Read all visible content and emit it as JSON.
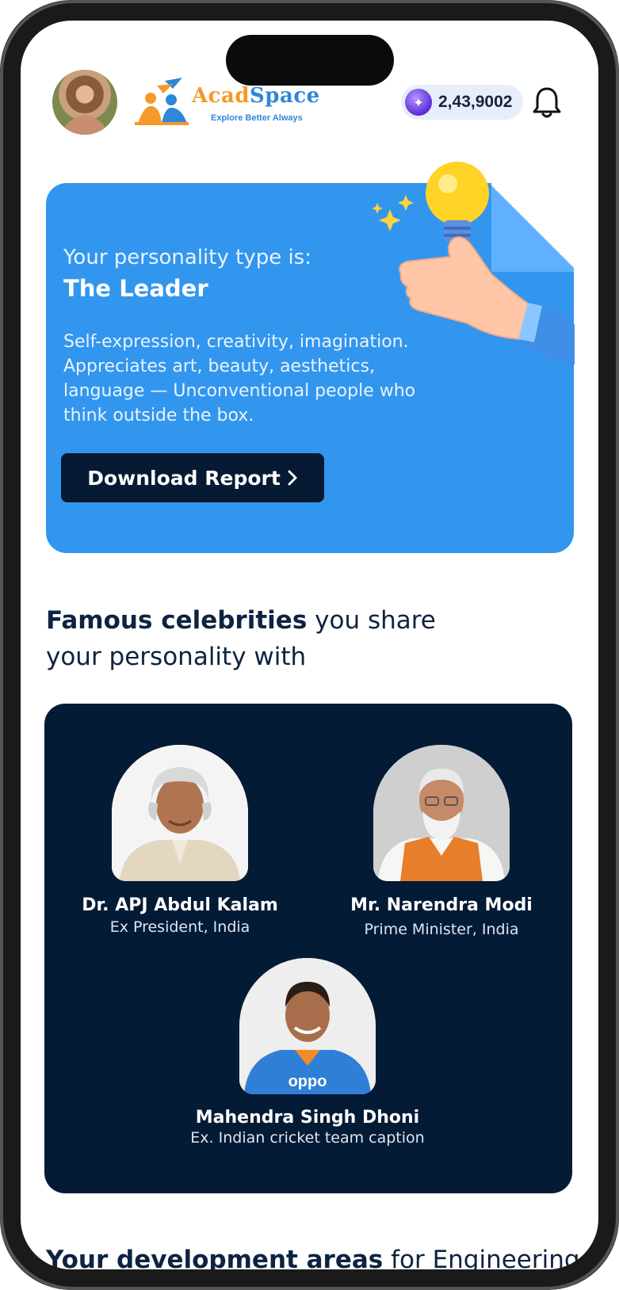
{
  "header": {
    "logo_title_part1": "Acad",
    "logo_title_part2": "Space",
    "logo_tagline": "Explore Better Always",
    "coins": "2,43,9002",
    "icons": [
      "avatar",
      "coin-icon",
      "bell-icon"
    ]
  },
  "hero": {
    "label": "Your personality type is:",
    "title": "The Leader",
    "description_lines": [
      "Self-expression, creativity, imagination.",
      "Appreciates art, beauty, aesthetics,",
      "language  — Unconventional people who",
      "think outside  the box."
    ],
    "button_label": "Download Report",
    "button_icon": "chevron-right-icon",
    "colors": {
      "card": "#3296ee",
      "button": "#061a33"
    }
  },
  "celebrities_section": {
    "heading_bold": "Famous celebrities",
    "heading_rest": " you share",
    "heading_line2": "your personality with",
    "people": [
      {
        "name": "Dr. APJ Abdul Kalam",
        "role": "Ex President, India"
      },
      {
        "name": "Mr. Narendra Modi",
        "role": "Prime Minister, India"
      },
      {
        "name": "Mahendra Singh Dhoni",
        "role": "Ex. Indian cricket team caption"
      }
    ],
    "colors": {
      "card": "#041b35"
    }
  },
  "next_section": {
    "heading_bold": "Your development areas",
    "heading_rest": " for Engineering"
  }
}
